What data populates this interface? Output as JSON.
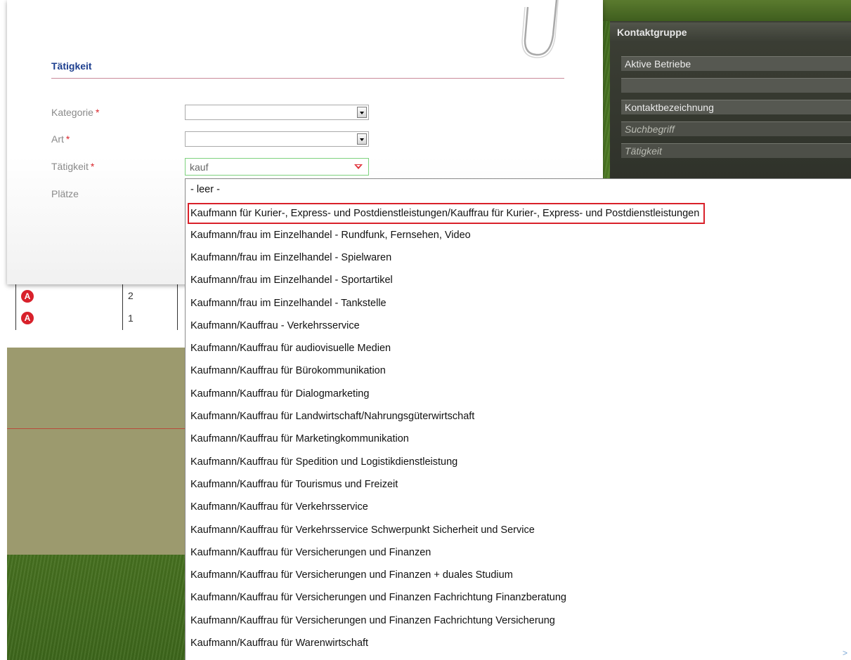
{
  "contact_panel": {
    "title": "Kontaktgruppe",
    "fields": [
      {
        "value": "Aktive Betriebe",
        "italic": false
      },
      {
        "value": "",
        "italic": false
      },
      {
        "value": "Kontaktbezeichnung",
        "italic": false
      },
      {
        "value": "Suchbegriff",
        "italic": true
      },
      {
        "value": "Tätigkeit",
        "italic": true
      }
    ]
  },
  "modal": {
    "section_title": "Tätigkeit",
    "labels": {
      "kategorie": "Kategorie",
      "art": "Art",
      "taetigkeit": "Tätigkeit",
      "plaetze": "Plätze",
      "required_mark": "*"
    },
    "kategorie_value": "",
    "art_value": "",
    "taetigkeit_value": "kauf"
  },
  "table": {
    "rows": [
      {
        "number": "2"
      },
      {
        "number": "1"
      }
    ]
  },
  "dropdown": {
    "items": [
      "- leer -",
      "Kaufmann für Kurier-, Express- und Postdienstleistungen/Kauffrau für Kurier-, Express- und Postdienstleistungen",
      "Kaufmann/frau im Einzelhandel - Rundfunk, Fernsehen, Video",
      "Kaufmann/frau im Einzelhandel - Spielwaren",
      "Kaufmann/frau im Einzelhandel - Sportartikel",
      "Kaufmann/frau im Einzelhandel - Tankstelle",
      "Kaufmann/Kauffrau - Verkehrsservice",
      "Kaufmann/Kauffrau für audiovisuelle Medien",
      "Kaufmann/Kauffrau für Bürokommunikation",
      "Kaufmann/Kauffrau für Dialogmarketing",
      "Kaufmann/Kauffrau für Landwirtschaft/Nahrungsgüterwirtschaft",
      "Kaufmann/Kauffrau für Marketingkommunikation",
      "Kaufmann/Kauffrau für Spedition und Logistikdienstleistung",
      "Kaufmann/Kauffrau für Tourismus und Freizeit",
      "Kaufmann/Kauffrau für Verkehrsservice",
      "Kaufmann/Kauffrau für Verkehrsservice Schwerpunkt Sicherheit und Service",
      "Kaufmann/Kauffrau für Versicherungen und Finanzen",
      "Kaufmann/Kauffrau für Versicherungen und Finanzen + duales Studium",
      "Kaufmann/Kauffrau für Versicherungen und Finanzen Fachrichtung Finanzberatung",
      "Kaufmann/Kauffrau für Versicherungen und Finanzen Fachrichtung Versicherung",
      "Kaufmann/Kauffrau für Warenwirtschaft"
    ],
    "highlighted_index": 1,
    "more_indicator": ">"
  },
  "colors": {
    "accent_red": "#d9212a",
    "title_blue": "#1d3f8f",
    "focus_green": "#7ed27e"
  },
  "icons": {
    "row_icon": "agency-logo-icon",
    "clip": "paperclip-icon"
  }
}
